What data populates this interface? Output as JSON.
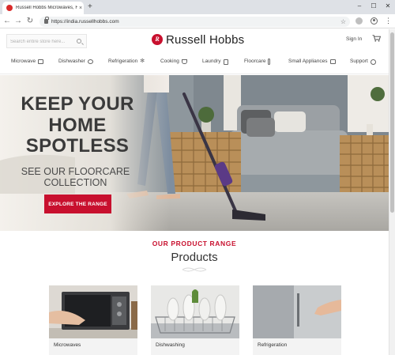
{
  "browser": {
    "tab_title": "Russell Hobbs Microwaves, Floor",
    "tab_close": "×",
    "new_tab": "+",
    "url": "https://india.russellhobbs.com",
    "window_min": "–",
    "window_max": "☐",
    "window_close": "✕",
    "back": "←",
    "forward": "→",
    "reload": "↻",
    "bookmark": "☆",
    "menu": "⋮"
  },
  "header": {
    "search_placeholder": "Search entire store here...",
    "logo_text": "Russell Hobbs",
    "logo_mark": "R",
    "signin": "Sign In"
  },
  "nav": {
    "items": [
      {
        "label": "Microwave",
        "icon": "microwave-icon"
      },
      {
        "label": "Dishwasher",
        "icon": "dishwasher-icon"
      },
      {
        "label": "Refrigeration",
        "icon": "snowflake-icon"
      },
      {
        "label": "Cooking",
        "icon": "pot-icon"
      },
      {
        "label": "Laundry",
        "icon": "washer-icon"
      },
      {
        "label": "Floorcare",
        "icon": "vacuum-icon"
      },
      {
        "label": "Small Appliances",
        "icon": "appliance-icon"
      },
      {
        "label": "Support",
        "icon": "support-icon"
      }
    ]
  },
  "hero": {
    "title_line1": "KEEP YOUR",
    "title_line2": "HOME",
    "title_line3": "SPOTLESS",
    "subtitle_line1": "SEE OUR FLOORCARE",
    "subtitle_line2": "COLLECTION",
    "cta": "EXPLORE THE RANGE"
  },
  "products": {
    "kicker": "OUR PRODUCT RANGE",
    "title": "Products",
    "cards": [
      {
        "label": "Microwaves"
      },
      {
        "label": "Dishwashing"
      },
      {
        "label": "Refrigeration"
      }
    ]
  },
  "colors": {
    "brand_red": "#c8102e",
    "text_dark": "#333333"
  }
}
